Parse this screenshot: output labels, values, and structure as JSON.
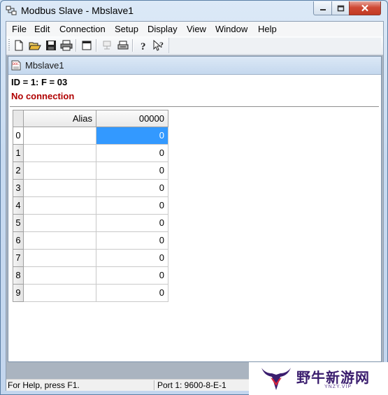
{
  "window": {
    "title": "Modbus Slave - Mbslave1"
  },
  "menu": [
    "File",
    "Edit",
    "Connection",
    "Setup",
    "Display",
    "View",
    "Window",
    "Help"
  ],
  "toolbar": {
    "icons": [
      "new-icon",
      "open-icon",
      "save-icon",
      "print-icon",
      "window-icon",
      "communication-icon",
      "printer-icon",
      "help-icon",
      "context-help-icon"
    ]
  },
  "child_window": {
    "title": "Mbslave1",
    "id_line": "ID = 1: F = 03",
    "connection_status": "No connection"
  },
  "table": {
    "columns": [
      "Alias",
      "00000"
    ],
    "rows": [
      {
        "index": "0",
        "alias": "",
        "value": "0"
      },
      {
        "index": "1",
        "alias": "",
        "value": "0"
      },
      {
        "index": "2",
        "alias": "",
        "value": "0"
      },
      {
        "index": "3",
        "alias": "",
        "value": "0"
      },
      {
        "index": "4",
        "alias": "",
        "value": "0"
      },
      {
        "index": "5",
        "alias": "",
        "value": "0"
      },
      {
        "index": "6",
        "alias": "",
        "value": "0"
      },
      {
        "index": "7",
        "alias": "",
        "value": "0"
      },
      {
        "index": "8",
        "alias": "",
        "value": "0"
      },
      {
        "index": "9",
        "alias": "",
        "value": "0"
      }
    ],
    "selected_row": 0
  },
  "status_bar": {
    "help": "For Help, press F1.",
    "port": "Port 1: 9600-8-E-1"
  },
  "watermark": {
    "text": "野牛新游网",
    "sub": "YNZY.VIP"
  },
  "colors": {
    "selection": "#3399ff",
    "status_error": "#b00000"
  }
}
